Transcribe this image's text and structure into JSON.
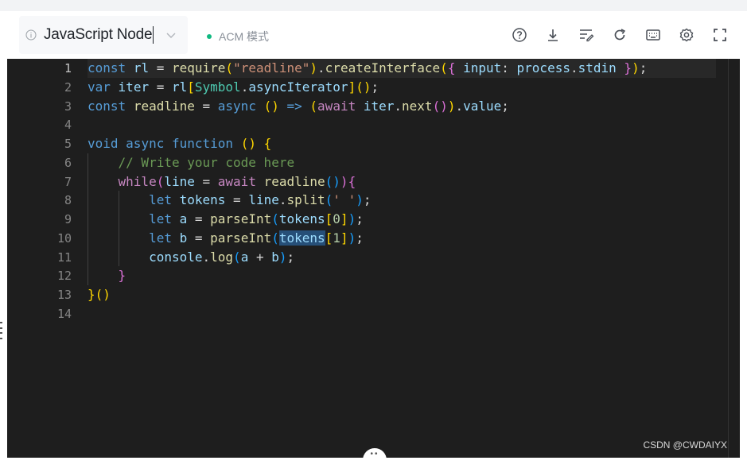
{
  "toolbar": {
    "language": "JavaScript Node",
    "mode_label": "ACM 模式",
    "mode_status_color": "#10b981",
    "icons": [
      "help-icon",
      "download-icon",
      "format-icon",
      "reset-icon",
      "keyboard-icon",
      "settings-icon",
      "fullscreen-icon"
    ]
  },
  "editor": {
    "line_numbers": [
      "1",
      "2",
      "3",
      "4",
      "5",
      "6",
      "7",
      "8",
      "9",
      "10",
      "11",
      "12",
      "13",
      "14"
    ],
    "active_line": "1"
  },
  "watermark": "CSDN @CWDAIYX"
}
